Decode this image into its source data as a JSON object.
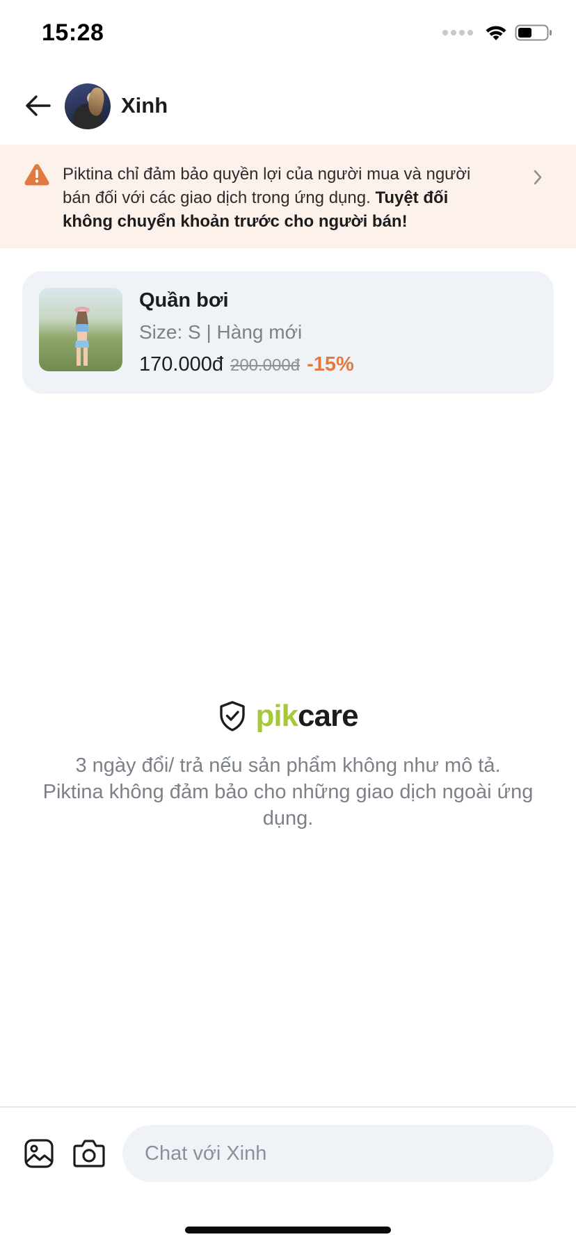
{
  "status_bar": {
    "time": "15:28"
  },
  "header": {
    "contact_name": "Xinh"
  },
  "warning": {
    "text_regular": "Piktina chỉ đảm bảo quyền lợi của người mua và người bán đối với các giao dịch trong ứng dụng. ",
    "text_bold": "Tuyệt đối không chuyển khoản trước cho người bán!"
  },
  "product": {
    "title": "Quần bơi",
    "meta": "Size: S | Hàng mới",
    "price_now": "170.000đ",
    "price_old": "200.000đ",
    "discount": "-15%"
  },
  "pikcare": {
    "logo_pik": "pik",
    "logo_care": "care",
    "line1": "3 ngày đổi/ trả nếu sản phẩm không như mô tả.",
    "line2": "Piktina không đảm bảo cho những giao dịch ngoài ứng dụng."
  },
  "composer": {
    "placeholder": "Chat với Xinh"
  },
  "colors": {
    "accent_orange": "#e07a3f",
    "warning_bg": "#fdf1eb",
    "pik_green": "#a6c93c",
    "card_bg": "#eff3f7"
  },
  "icons": {
    "back": "arrow-left-icon",
    "warning": "warning-triangle-icon",
    "chevron": "chevron-right-icon",
    "shield": "shield-check-icon",
    "gallery": "image-icon",
    "camera": "camera-icon"
  }
}
